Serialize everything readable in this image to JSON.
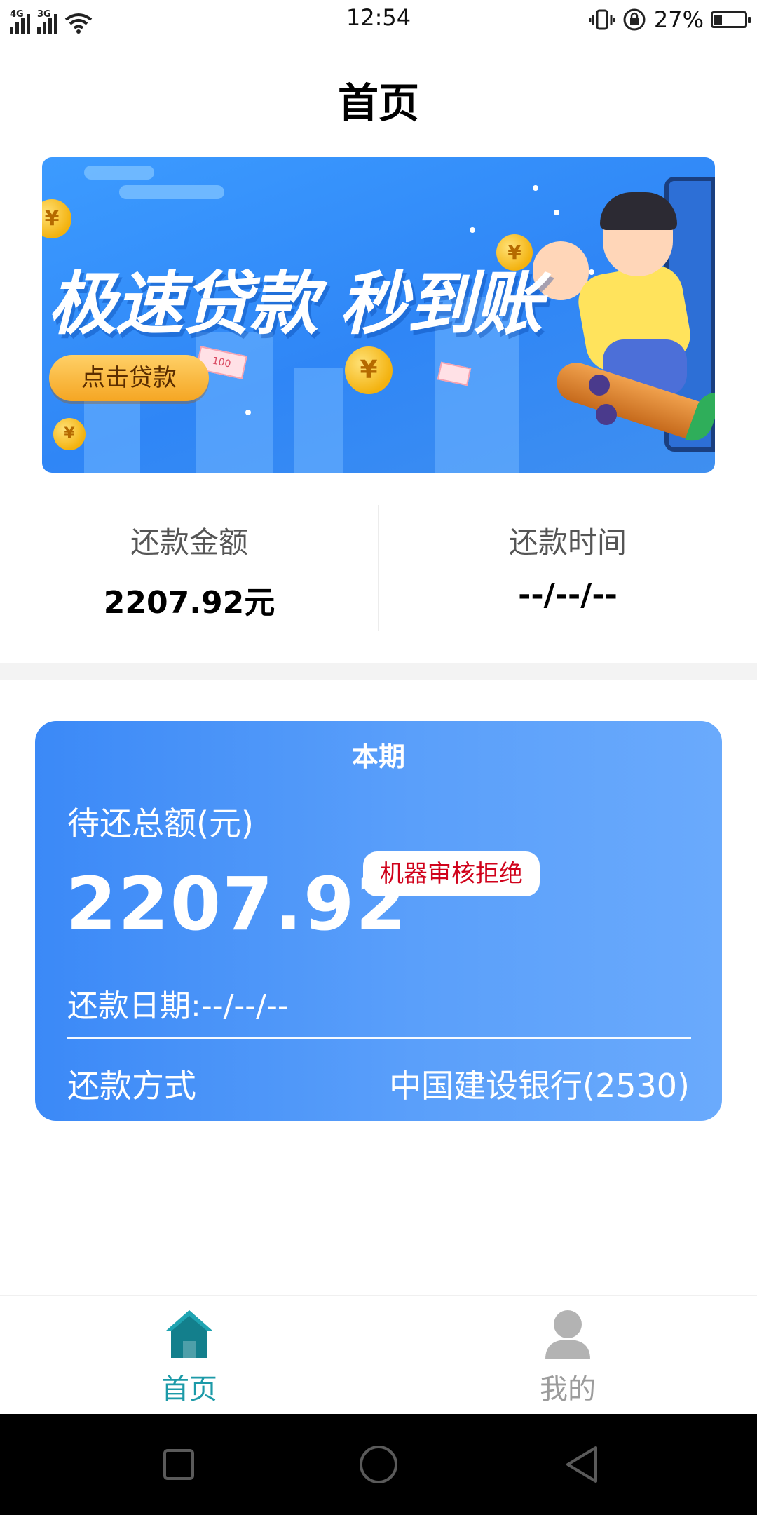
{
  "status_bar": {
    "net1": "4G",
    "net2": "3G",
    "time": "12:54",
    "battery": "27%",
    "battery_level": 0.27
  },
  "header": {
    "title": "首页"
  },
  "banner": {
    "headline": "极速贷款 秒到账",
    "cta": "点击贷款",
    "coin_symbol": "¥",
    "bill_value": "100"
  },
  "summary": {
    "amount_label": "还款金额",
    "amount_value": "2207.92元",
    "time_label": "还款时间",
    "time_value": "--/--/--"
  },
  "card": {
    "title": "本期",
    "total_label": "待还总额(元)",
    "total_value": "2207.92",
    "badge": "机器审核拒绝",
    "due_date": "还款日期:--/--/--",
    "method_label": "还款方式",
    "method_value": "中国建设银行(2530)"
  },
  "bottom_nav": {
    "items": [
      {
        "label": "首页",
        "icon": "home-icon",
        "active": true
      },
      {
        "label": "我的",
        "icon": "person-icon",
        "active": false
      }
    ]
  },
  "colors": {
    "card_start": "#3b89f7",
    "card_end": "#6aaafc",
    "badge_text": "#d0021b",
    "nav_active": "#1c9aa8",
    "nav_inactive": "#9c9c9c"
  }
}
